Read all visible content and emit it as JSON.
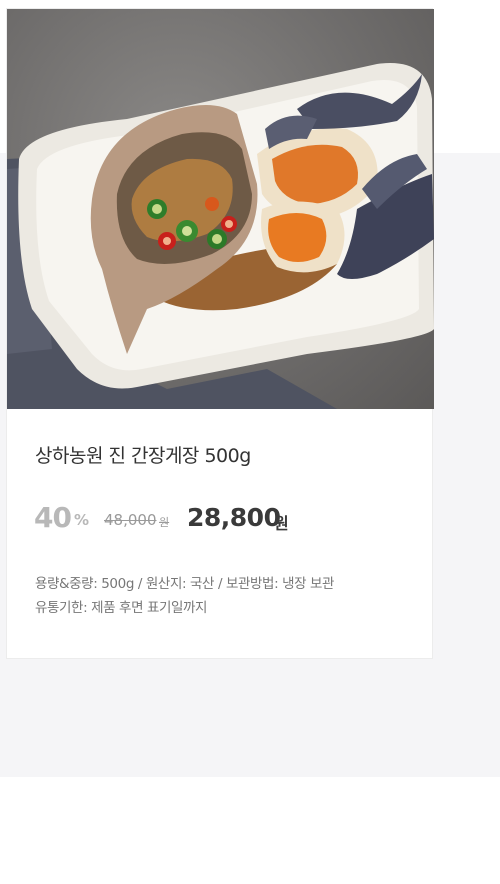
{
  "product": {
    "image_icon": "crab-dish-photo",
    "title": "상하농원 진 간장게장 500g",
    "discount": {
      "value": "40",
      "unit": "%"
    },
    "original_price": {
      "value": "48,000",
      "unit": "원"
    },
    "sale_price": {
      "value": "28,800",
      "unit": "원"
    },
    "info_line_1": "용량&중량: 500g / 원산지: 국산 / 보관방법: 냉장 보관",
    "info_line_2": "유통기한: 제품 후면 표기일까지"
  },
  "colors": {
    "panel_bg": "#f5f5f7",
    "card_bg": "#ffffff",
    "muted": "#b8b8b8",
    "price": "#3a3a3a"
  }
}
